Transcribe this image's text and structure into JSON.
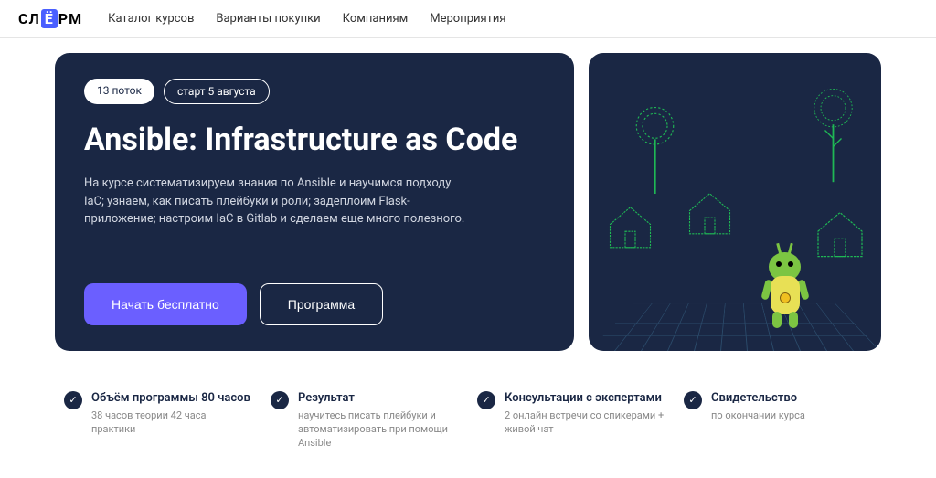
{
  "logo": {
    "part1": "СЛ",
    "part2": "Ё",
    "part3": "РМ"
  },
  "nav": {
    "items": [
      "Каталог курсов",
      "Варианты покупки",
      "Компаниям",
      "Мероприятия"
    ]
  },
  "hero": {
    "badge_stream": "13 поток",
    "badge_start": "старт 5 августа",
    "title": "Ansible: Infrastructure as Code",
    "description": "На курсе систематизируем знания по Ansible и научимся подходу IaC; узнаем, как писать плейбуки и роли; задеплоим Flask-приложение; настроим IaC в Gitlab и сделаем еще много полезного.",
    "btn_start": "Начать бесплатно",
    "btn_program": "Программа"
  },
  "features": [
    {
      "title": "Объём программы 80 часов",
      "desc": "38 часов теории\n42 часа практики"
    },
    {
      "title": "Результат",
      "desc": "научитесь писать плейбуки и автоматизировать при помощи Ansible"
    },
    {
      "title": "Консультации с экспертами",
      "desc": "2 онлайн встречи со спикерами + живой чат"
    },
    {
      "title": "Свидетельство",
      "desc": "по окончании курса"
    }
  ]
}
